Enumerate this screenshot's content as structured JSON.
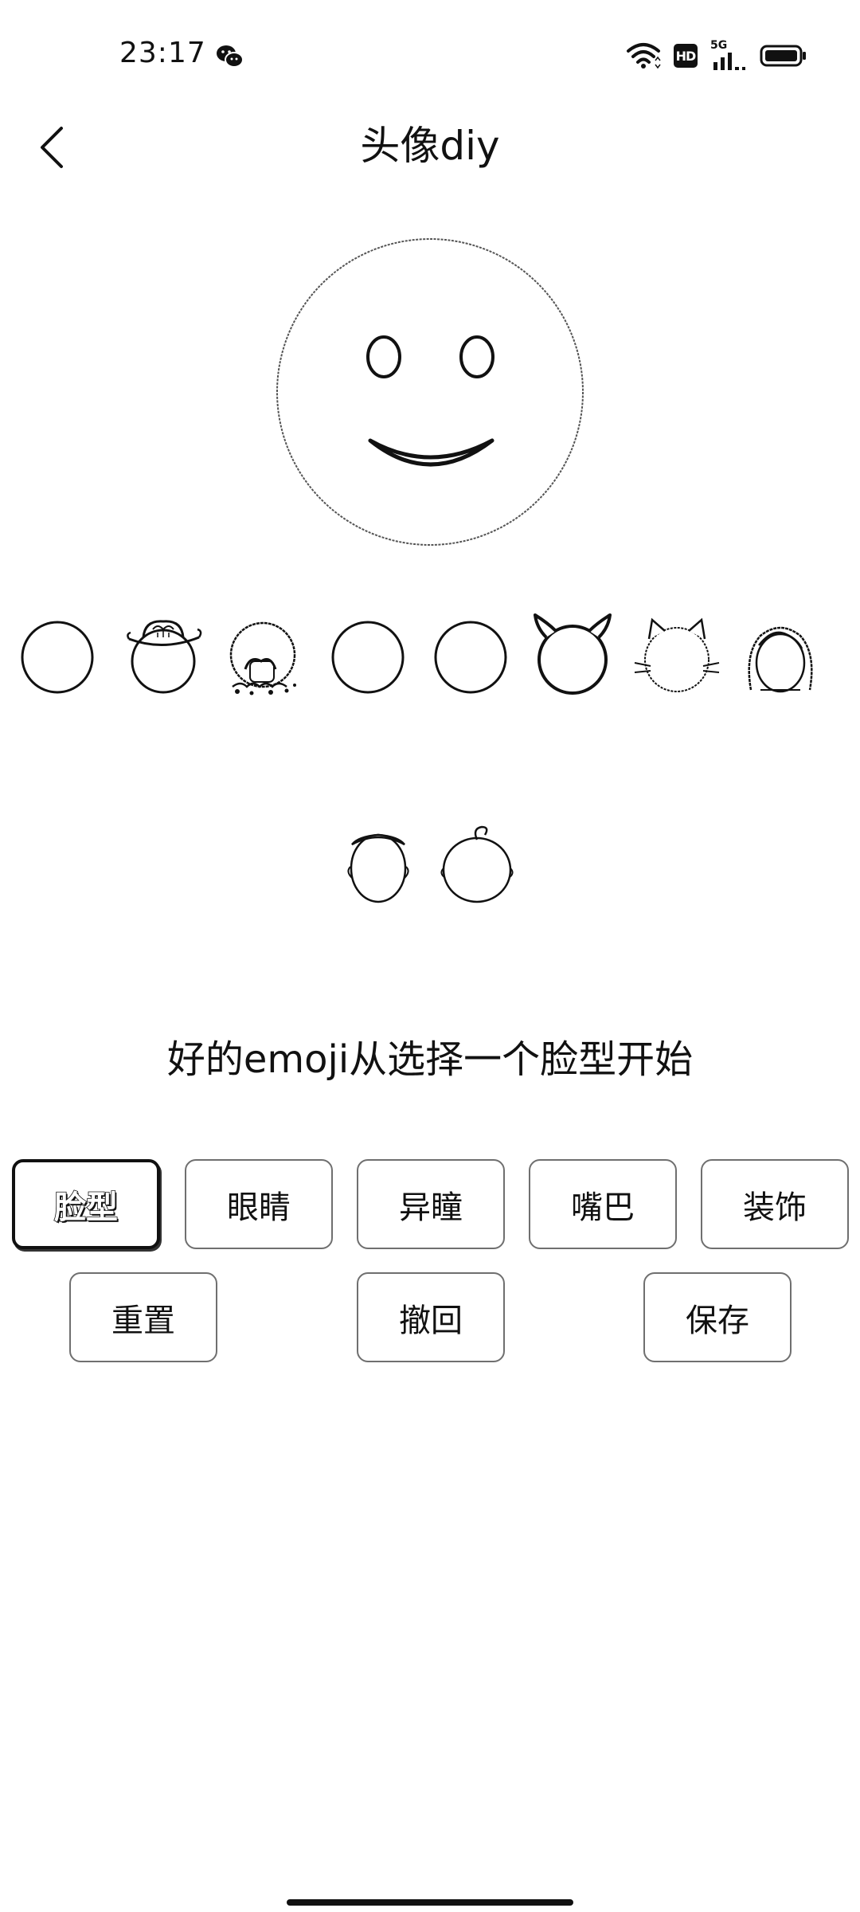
{
  "status_bar": {
    "time": "23:17",
    "hd_label": "HD",
    "network_label": "5G",
    "icons": [
      "wechat-icon",
      "wifi-icon",
      "hd-icon",
      "signal-5g-icon",
      "battery-icon"
    ]
  },
  "header": {
    "title": "头像diy",
    "back_icon": "chevron-left-icon"
  },
  "face_options": [
    {
      "name": "plain-circle-face"
    },
    {
      "name": "cowboy-hat-face"
    },
    {
      "name": "mushroom-face"
    },
    {
      "name": "plain-circle-face-2"
    },
    {
      "name": "plain-circle-face-3"
    },
    {
      "name": "devil-horns-face"
    },
    {
      "name": "cat-ears-face"
    },
    {
      "name": "long-hair-face"
    },
    {
      "name": "short-hair-face"
    },
    {
      "name": "baby-curl-face"
    }
  ],
  "hint": "好的emoji从选择一个脸型开始",
  "tabs": [
    {
      "label": "脸型",
      "active": true
    },
    {
      "label": "眼睛",
      "active": false
    },
    {
      "label": "异瞳",
      "active": false
    },
    {
      "label": "嘴巴",
      "active": false
    },
    {
      "label": "装饰",
      "active": false
    }
  ],
  "actions": {
    "reset": "重置",
    "undo": "撤回",
    "save": "保存"
  }
}
